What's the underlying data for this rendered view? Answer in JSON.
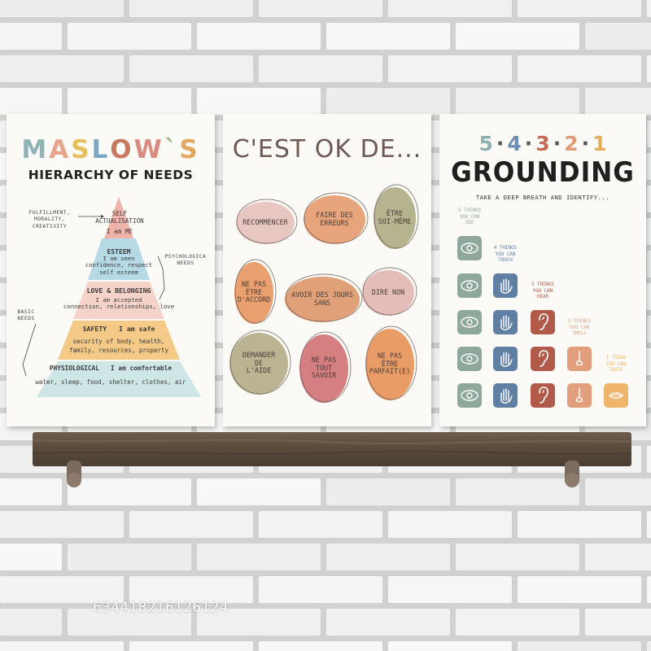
{
  "maslow": {
    "title_letters": [
      {
        "ch": "M",
        "color": "#8fb4b8"
      },
      {
        "ch": "A",
        "color": "#e9a48c"
      },
      {
        "ch": "S",
        "color": "#e6c05c"
      },
      {
        "ch": "L",
        "color": "#7ea6c2"
      },
      {
        "ch": "O",
        "color": "#c7785e"
      },
      {
        "ch": "W",
        "color": "#d98b82"
      },
      {
        "ch": "`",
        "color": "#a1b08d"
      },
      {
        "ch": "S",
        "color": "#e3a85f"
      }
    ],
    "subtitle": "HIERARCHY OF NEEDS",
    "levels": [
      {
        "name": "SELF\nACTUALISATION",
        "desc": "I am ME",
        "color": "#efb3a9"
      },
      {
        "name": "ESTEEM",
        "desc": "I am seen\nconfidence, respect\nself esteem",
        "color": "#a9d2e3"
      },
      {
        "name": "LOVE & BELONGING",
        "desc": "I am accepted\nconnection, relationships, love",
        "color": "#f5d3c9"
      },
      {
        "name": "SAFETY   I am safe",
        "desc": "security of body, health,\nfamily, resources, property",
        "color": "#f5c986"
      },
      {
        "name": "PHYSIOLOGICAL   I am comfortable",
        "desc": "water, sleep, food, shelter, clothes, air",
        "color": "#cfe6e6"
      }
    ],
    "side_fulfillment": "FULFILLMENT,\nMORALITY,\nCREATIVITY",
    "side_psychological": "PSYCHOLOGICA\nNEEDS",
    "side_basic": "BASIC\nNEEDS"
  },
  "cestok": {
    "title": "C'EST OK DE...",
    "bubbles": [
      {
        "text": "RECOMMENCER",
        "color": "#e8c7c3"
      },
      {
        "text": "FAIRE DES\nERREURS",
        "color": "#e8a47a"
      },
      {
        "text": "ÊTRE\nSOI-MÊME",
        "color": "#b6b48e"
      },
      {
        "text": "NE PAS\nÊTRE\nD'ACCORD",
        "color": "#e9a06e"
      },
      {
        "text": "AVOIR DES JOURS\nSANS",
        "color": "#e0a178"
      },
      {
        "text": "DIRE NON",
        "color": "#e5bdb8"
      },
      {
        "text": "DEMANDER\nDE\nL'AIDE",
        "color": "#bab493"
      },
      {
        "text": "NE PAS\nTOUT\nSAVOIR",
        "color": "#d67f80"
      },
      {
        "text": "NE PAS\nÊTRE\nPARFAIT(E)",
        "color": "#e99c66"
      }
    ]
  },
  "grounding": {
    "numbers": [
      {
        "n": "5",
        "color": "#8fb0b0"
      },
      {
        "n": "4",
        "color": "#6d8fb3"
      },
      {
        "n": "3",
        "color": "#c46a55"
      },
      {
        "n": "2",
        "color": "#e39a72"
      },
      {
        "n": "1",
        "color": "#e7ad55"
      }
    ],
    "title": "GROUNDING",
    "subtitle": "TAKE A DEEP BREATH AND IDENTIFY...",
    "columns": [
      {
        "label": "5 THINGS\nYOU CAN\nSEE",
        "color": "#8fa89c",
        "icon": "eye-icon",
        "count": 5
      },
      {
        "label": "4 THINGS\nYOU CAN\nTOUCH",
        "color": "#5f7fa3",
        "icon": "hand-icon",
        "count": 4
      },
      {
        "label": "3 THINGS\nYOU CAN\nHEAR",
        "color": "#b25a4a",
        "icon": "ear-icon",
        "count": 3
      },
      {
        "label": "2 THINGS\nYOU CAN\nSMELL",
        "color": "#e29f7d",
        "icon": "nose-icon",
        "count": 2
      },
      {
        "label": "1 THING\nYOU CAN\nTASTE",
        "color": "#f0b56c",
        "icon": "mouth-icon",
        "count": 1
      }
    ]
  },
  "watermark": "634418216126124"
}
